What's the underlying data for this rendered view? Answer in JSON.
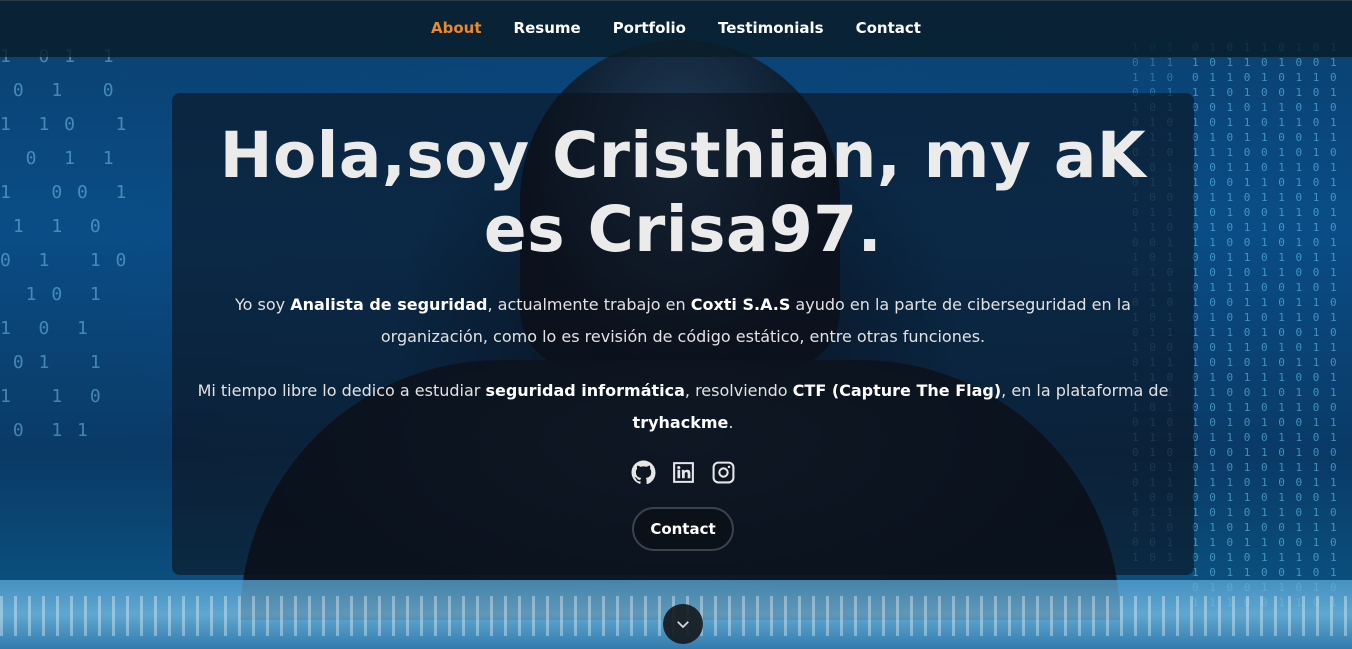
{
  "nav": {
    "items": [
      {
        "label": "About",
        "active": true
      },
      {
        "label": "Resume",
        "active": false
      },
      {
        "label": "Portfolio",
        "active": false
      },
      {
        "label": "Testimonials",
        "active": false
      },
      {
        "label": "Contact",
        "active": false
      }
    ],
    "active_color": "#e8892b"
  },
  "hero": {
    "title": "Hola,soy Cristhian, my aK es Crisa97.",
    "para1": {
      "t1": "Yo soy ",
      "b1": "Analista de seguridad",
      "t2": ", actualmente trabajo en ",
      "b2": "Coxti S.A.S",
      "t3": " ayudo en la parte de ciberseguridad en la organización, como lo es revisión de código estático, entre otras funciones."
    },
    "para2": {
      "t1": "Mi tiempo libre lo dedico a estudiar ",
      "b1": "seguridad informática",
      "t2": ", resolviendo ",
      "b2": "CTF (Capture The Flag)",
      "t3": ", en la plataforma de ",
      "b3": "tryhackme",
      "t4": "."
    },
    "social": [
      "github-icon",
      "linkedin-icon",
      "instagram-icon"
    ],
    "contact_button": "Contact"
  },
  "scroll_icon": "chevron-down-icon"
}
